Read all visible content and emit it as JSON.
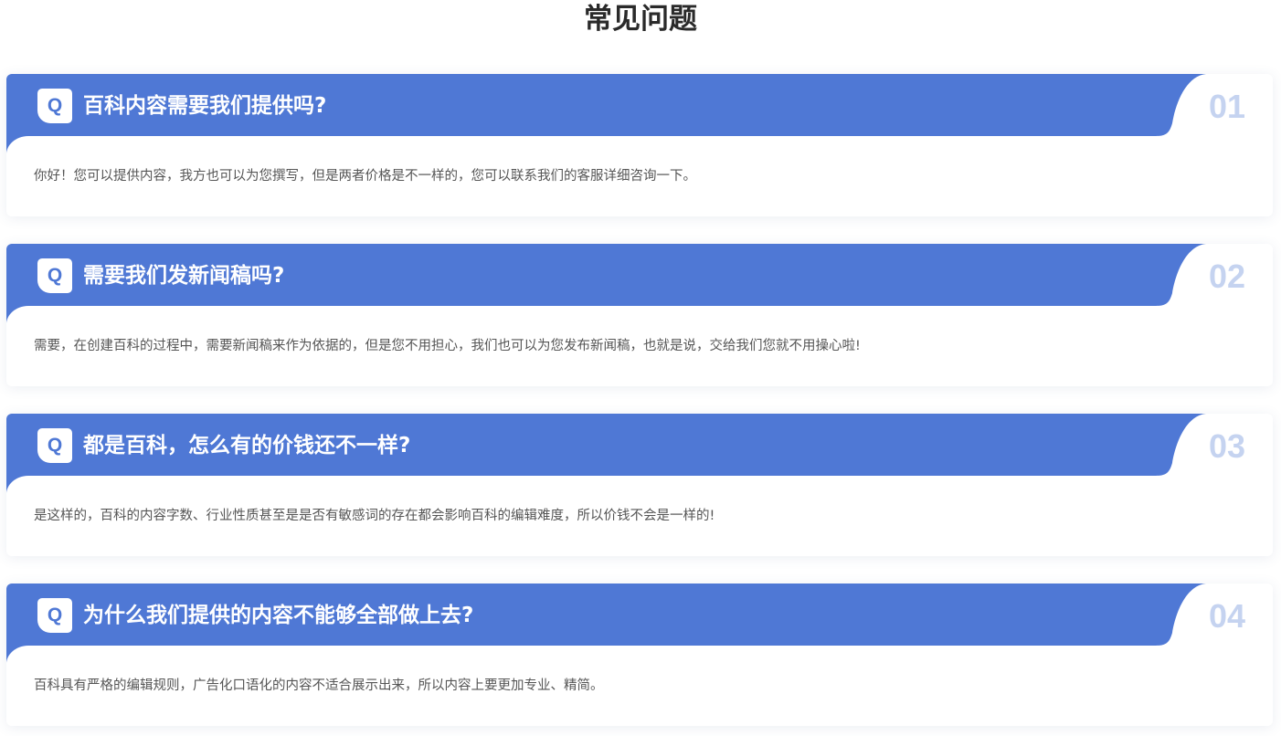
{
  "page": {
    "title": "常见问题"
  },
  "colors": {
    "accent": "#4f78d5",
    "number": "#c5d3f0",
    "answer_text": "#555555",
    "title_text": "#2a2a2a"
  },
  "faq": [
    {
      "badge": "Q",
      "number": "01",
      "question": "百科内容需要我们提供吗?",
      "answer": "你好！您可以提供内容，我方也可以为您撰写，但是两者价格是不一样的，您可以联系我们的客服详细咨询一下。"
    },
    {
      "badge": "Q",
      "number": "02",
      "question": "需要我们发新闻稿吗?",
      "answer": "需要，在创建百科的过程中，需要新闻稿来作为依据的，但是您不用担心，我们也可以为您发布新闻稿，也就是说，交给我们您就不用操心啦!"
    },
    {
      "badge": "Q",
      "number": "03",
      "question": "都是百科，怎么有的价钱还不一样?",
      "answer": "是这样的，百科的内容字数、行业性质甚至是是否有敏感词的存在都会影响百科的编辑难度，所以价钱不会是一样的!"
    },
    {
      "badge": "Q",
      "number": "04",
      "question": "为什么我们提供的内容不能够全部做上去?",
      "answer": "百科具有严格的编辑规则，广告化口语化的内容不适合展示出来，所以内容上要更加专业、精简。"
    }
  ]
}
